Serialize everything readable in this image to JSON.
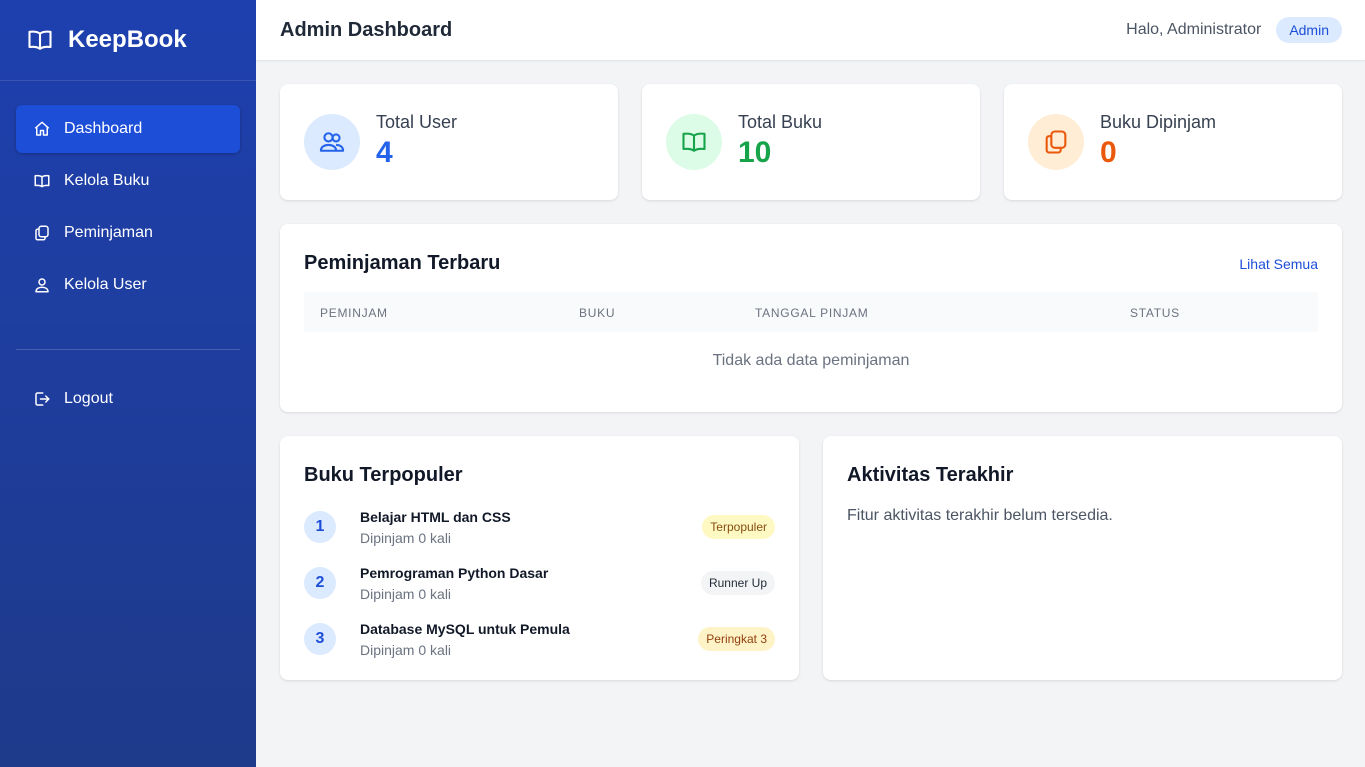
{
  "brand": {
    "name": "KeepBook",
    "icon": "book-open-icon"
  },
  "sidebar": {
    "items": [
      {
        "label": "Dashboard",
        "icon": "home-icon",
        "active": true
      },
      {
        "label": "Kelola Buku",
        "icon": "book-open-icon",
        "active": false
      },
      {
        "label": "Peminjaman",
        "icon": "copy-icon",
        "active": false
      },
      {
        "label": "Kelola User",
        "icon": "users-icon",
        "active": false
      }
    ],
    "logout": {
      "label": "Logout",
      "icon": "logout-icon"
    }
  },
  "header": {
    "title": "Admin Dashboard",
    "greeting": "Halo, Administrator",
    "role": "Admin"
  },
  "stats": [
    {
      "label": "Total User",
      "value": "4",
      "icon": "users-icon",
      "color": "#2563eb",
      "bg": "#dbeafe"
    },
    {
      "label": "Total Buku",
      "value": "10",
      "icon": "book-open-icon",
      "color": "#16a34a",
      "bg": "#dcfce7"
    },
    {
      "label": "Buku Dipinjam",
      "value": "0",
      "icon": "copy-icon",
      "color": "#ea580c",
      "bg": "#ffedd5"
    }
  ],
  "loans": {
    "title": "Peminjaman Terbaru",
    "view_all": "Lihat Semua",
    "columns": [
      "PEMINJAM",
      "BUKU",
      "TANGGAL PINJAM",
      "STATUS"
    ],
    "empty": "Tidak ada data peminjaman"
  },
  "popular": {
    "title": "Buku Terpopuler",
    "items": [
      {
        "rank": "1",
        "title": "Belajar HTML dan CSS",
        "sub": "Dipinjam 0 kali",
        "badge": "Terpopuler",
        "badge_bg": "#fef9c3",
        "badge_color": "#854d0e"
      },
      {
        "rank": "2",
        "title": "Pemrograman Python Dasar",
        "sub": "Dipinjam 0 kali",
        "badge": "Runner Up",
        "badge_bg": "#f3f4f6",
        "badge_color": "#1f2937"
      },
      {
        "rank": "3",
        "title": "Database MySQL untuk Pemula",
        "sub": "Dipinjam 0 kali",
        "badge": "Peringkat 3",
        "badge_bg": "#fef3c7",
        "badge_color": "#92400e"
      }
    ]
  },
  "activity": {
    "title": "Aktivitas Terakhir",
    "text": "Fitur aktivitas terakhir belum tersedia."
  }
}
